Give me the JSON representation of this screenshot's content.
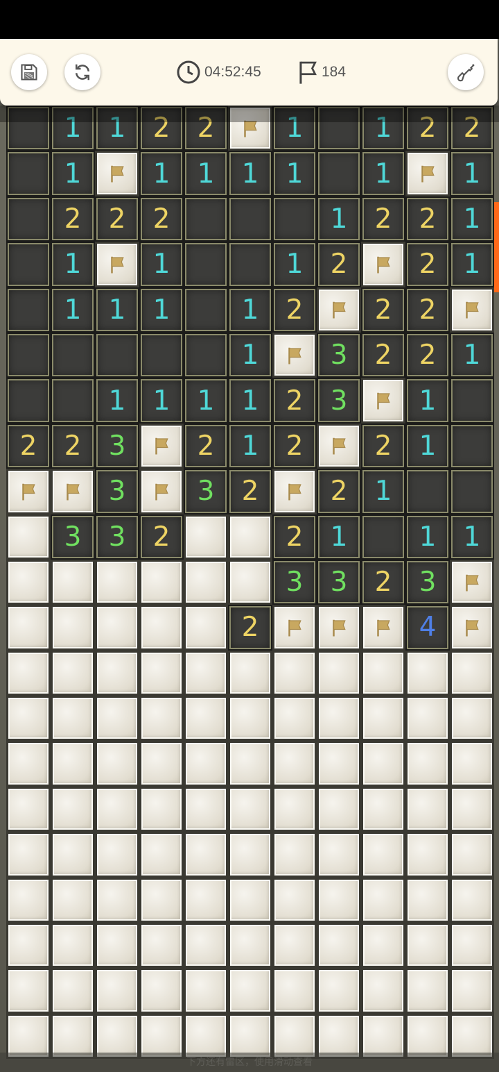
{
  "toolbar": {
    "save_icon": "floppy-disk-icon",
    "restart_icon": "refresh-icon",
    "timer_icon": "clock-icon",
    "timer": "04:52:45",
    "flags_icon": "flag-icon",
    "flags_remaining": "184",
    "tool_icon": "shovel-icon"
  },
  "colors": {
    "n1": "#4fd8d8",
    "n2": "#eed464",
    "n3": "#70e060",
    "n4": "#4f7fe6",
    "flag": "#c8a860",
    "scroll_indicator": "#ff6a1a"
  },
  "board": {
    "columns": 11,
    "legend": "O=open empty, C=covered, F=flagged, digit=open with mine count",
    "rows": [
      "O112 2F1O122",
      "O1F1111O1F1",
      "O222OOO1221",
      "O1F1OO12F21",
      "O111O12F22F",
      "OOOOO1F3221",
      "OO11112 3F1O",
      "2 23F212F21O",
      "FF3F32F21OO",
      "C332CC21O11",
      "CCCCCC3323F",
      "CCCCC2FFF4F",
      "CCCCCCCCCCC",
      "CCCCCCCCCCC",
      "CCCCCCCCCCC",
      "CCCCCCCCCCC",
      "CCCCCCCCCCC",
      "CCCCCCCCCCC",
      "CCCCCCCCCCC",
      "CCCCCCCCCCC",
      "CCCCCCCCCCC"
    ]
  },
  "hint": "下方还有雷区，使用滑动查看"
}
